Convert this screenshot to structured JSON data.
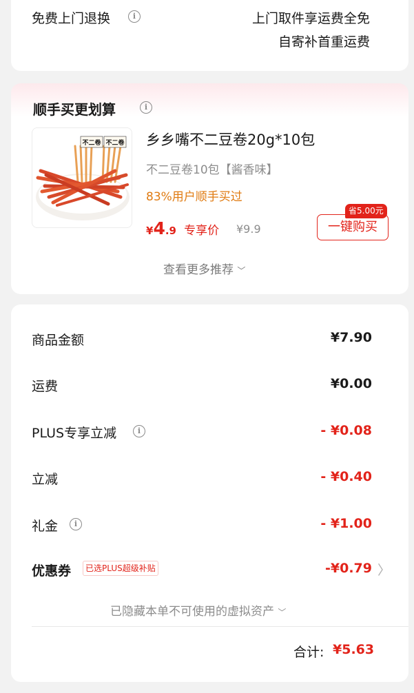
{
  "return_card": {
    "title": "免费上门退换",
    "line1": "上门取件享运费全免",
    "line2": "自寄补首重运费"
  },
  "bundle_card": {
    "title": "顺手买更划算",
    "product": {
      "name": "乡乡嘴不二豆卷20g*10包",
      "spec": "不二豆卷10包【酱香味】",
      "social_proof": "83%用户顺手买过",
      "price_symbol": "¥",
      "price_int": "4",
      "price_dec": ".9",
      "price_tag": "专享价",
      "original_price": "¥9.9",
      "save_badge": "省5.00元",
      "buy_button": "一键购买",
      "image_sign_text": "不二卷"
    },
    "more_link": "查看更多推荐"
  },
  "summary_card": {
    "rows": [
      {
        "label": "商品金额",
        "value": "¥7.90"
      },
      {
        "label": "运费",
        "value": "¥0.00"
      },
      {
        "label": "PLUS专享立减",
        "value": "- ¥0.08"
      },
      {
        "label": "立减",
        "value": "- ¥0.40"
      },
      {
        "label": "礼金",
        "value": "- ¥1.00"
      },
      {
        "label": "优惠券",
        "value": "-¥0.79"
      }
    ],
    "coupon_tag": "已选PLUS超级补贴",
    "hidden_assets": "已隐藏本单不可使用的虚拟资产",
    "total_label": "合计:",
    "total_value": "¥5.63"
  },
  "colors": {
    "accent_red": "#e2231a",
    "orange": "#e07b12",
    "background": "#f2f2f2"
  }
}
